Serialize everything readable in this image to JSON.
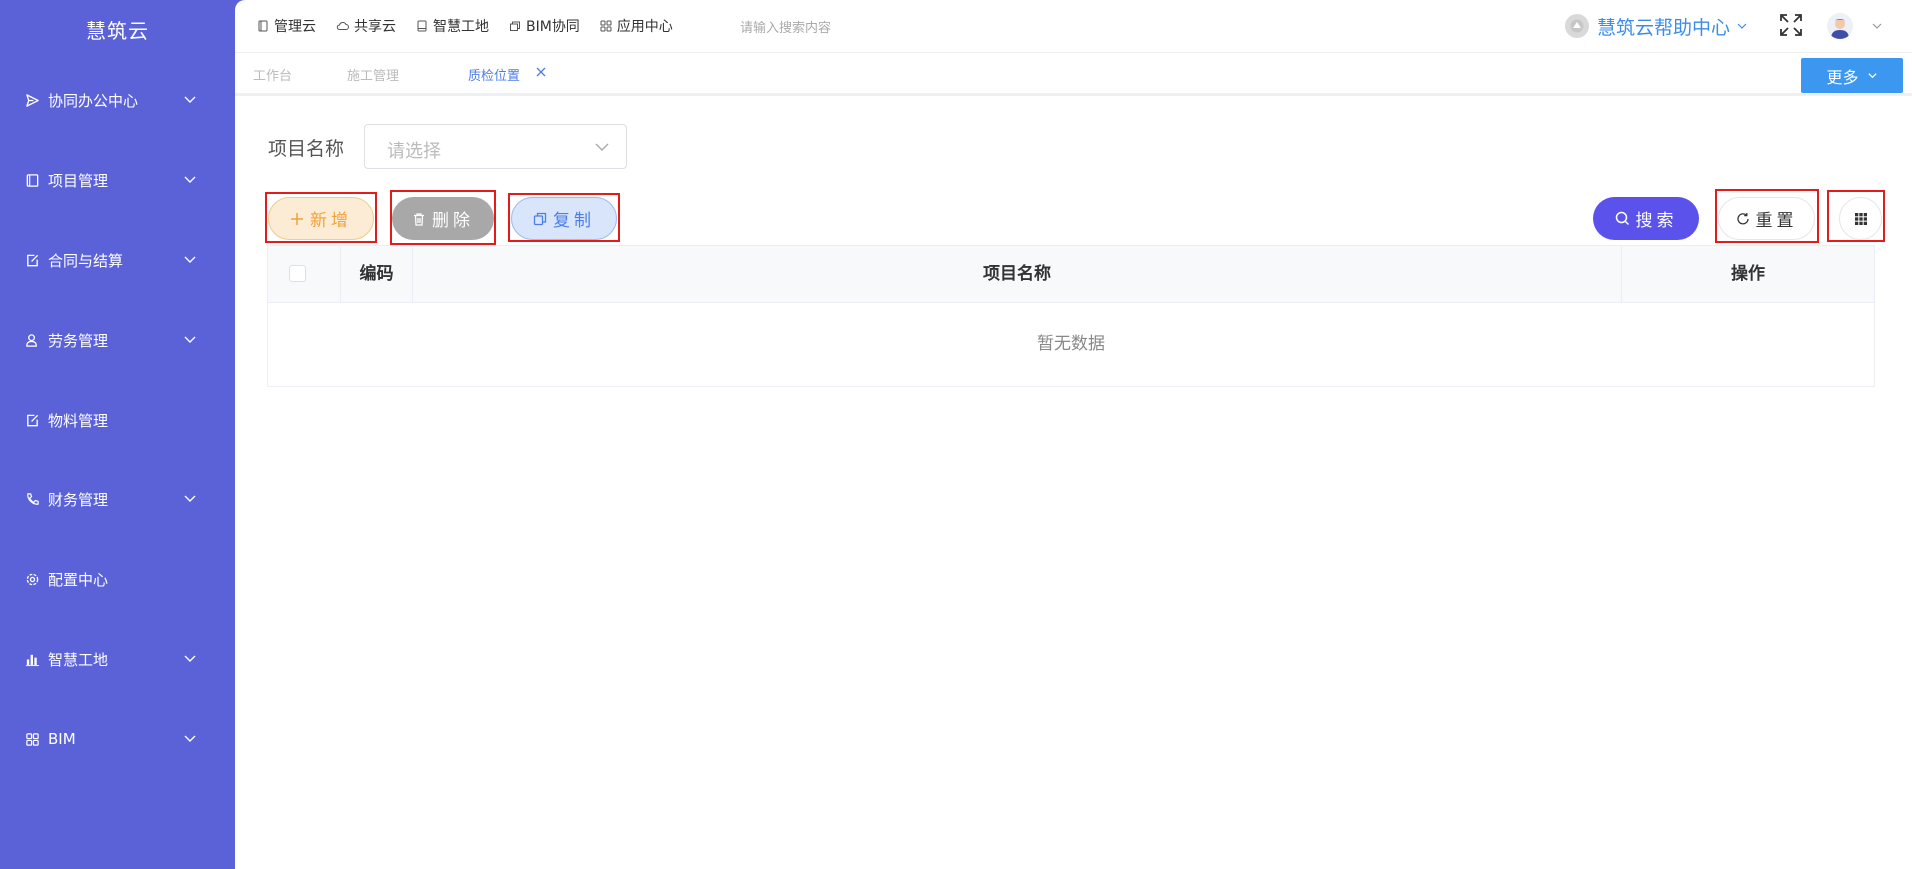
{
  "sidebar": {
    "brand": "慧筑云",
    "items": [
      {
        "label": "协同办公中心",
        "icon": "send-icon",
        "has_children": true
      },
      {
        "label": "项目管理",
        "icon": "book-icon",
        "has_children": true
      },
      {
        "label": "合同与结算",
        "icon": "edit-doc-icon",
        "has_children": true
      },
      {
        "label": "劳务管理",
        "icon": "user-icon",
        "has_children": true
      },
      {
        "label": "物料管理",
        "icon": "edit-doc-icon",
        "has_children": false
      },
      {
        "label": "财务管理",
        "icon": "phone-icon",
        "has_children": true
      },
      {
        "label": "配置中心",
        "icon": "gear-icon",
        "has_children": false
      },
      {
        "label": "智慧工地",
        "icon": "bar-chart-icon",
        "has_children": true
      },
      {
        "label": "BIM",
        "icon": "grid-icon",
        "has_children": true
      }
    ]
  },
  "topbar": {
    "nav": [
      {
        "label": "管理云",
        "icon": "doc-icon"
      },
      {
        "label": "共享云",
        "icon": "cloud-icon"
      },
      {
        "label": "智慧工地",
        "icon": "book-icon"
      },
      {
        "label": "BIM协同",
        "icon": "stack-icon"
      },
      {
        "label": "应用中心",
        "icon": "grid-icon"
      }
    ],
    "search_placeholder": "请输入搜索内容",
    "help_label": "慧筑云帮助中心"
  },
  "tabs": {
    "items": [
      {
        "label": "工作台",
        "active": false
      },
      {
        "label": "施工管理",
        "active": false
      },
      {
        "label": "质检位置",
        "active": true
      }
    ],
    "more_label": "更多"
  },
  "filter": {
    "project_label": "项目名称",
    "project_placeholder": "请选择"
  },
  "toolbar": {
    "add_label": "新增",
    "delete_label": "删除",
    "copy_label": "复制",
    "search_label": "搜索",
    "reset_label": "重置"
  },
  "table": {
    "columns": [
      "编码",
      "项目名称",
      "操作"
    ],
    "empty_text": "暂无数据"
  },
  "colors": {
    "sidebar_bg": "#5b62d8",
    "accent_blue": "#3b97f0",
    "search_btn": "#5b52ec",
    "add_btn_text": "#f0a23c",
    "highlight_box": "#e31b1b"
  }
}
